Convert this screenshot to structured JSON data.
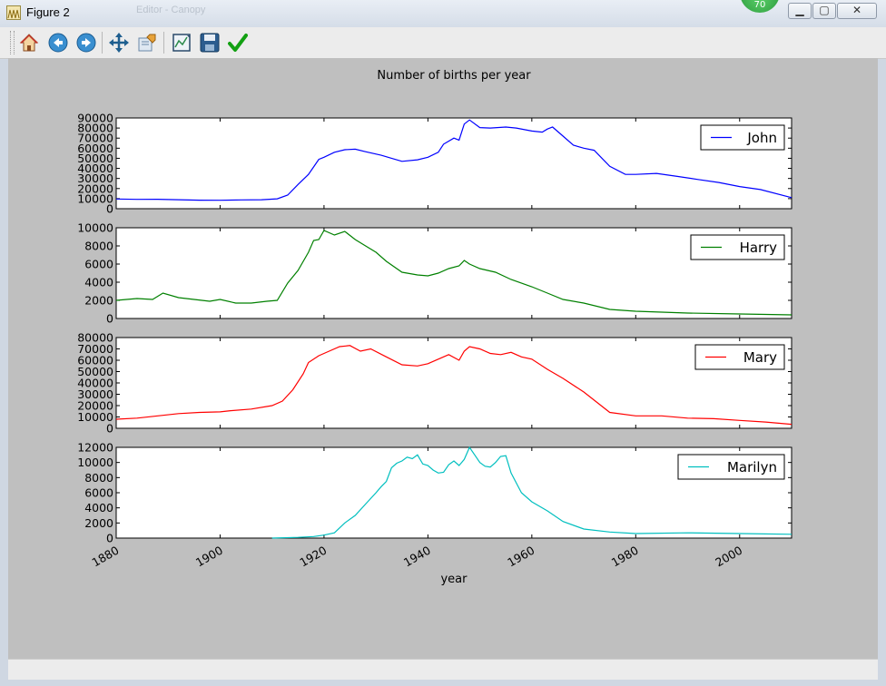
{
  "window": {
    "title": "Figure 2",
    "background_title": "Editor - Canopy",
    "badge": "70",
    "buttons": [
      {
        "name": "minimize-button",
        "glyph": "▁"
      },
      {
        "name": "maximize-button",
        "glyph": "▢"
      },
      {
        "name": "close-button",
        "glyph": "✕"
      }
    ]
  },
  "toolbar": {
    "items": [
      {
        "name": "home-icon"
      },
      {
        "name": "back-icon"
      },
      {
        "name": "forward-icon"
      },
      {
        "name": "pan-icon"
      },
      {
        "name": "zoom-icon"
      },
      {
        "name": "subplots-icon"
      },
      {
        "name": "save-icon"
      },
      {
        "name": "edit-axis-icon"
      }
    ]
  },
  "chart_data": {
    "type": "line",
    "title": "Number of births per year",
    "xlabel": "year",
    "xlim": [
      1880,
      2010
    ],
    "xticks": [
      "1880",
      "1900",
      "1920",
      "1940",
      "1960",
      "1980",
      "2000"
    ],
    "grid": false,
    "legend_placement": "right",
    "subplots": [
      {
        "name": "John",
        "color": "#0000ff",
        "ylim": [
          0,
          90000
        ],
        "yticks": [
          "0",
          "10000",
          "20000",
          "30000",
          "40000",
          "50000",
          "60000",
          "70000",
          "80000",
          "90000"
        ],
        "x": [
          1880,
          1884,
          1888,
          1892,
          1896,
          1900,
          1904,
          1908,
          1911,
          1913,
          1915,
          1917,
          1919,
          1920,
          1922,
          1924,
          1926,
          1928,
          1931,
          1933,
          1935,
          1938,
          1940,
          1942,
          1943,
          1945,
          1946,
          1947,
          1948,
          1950,
          1952,
          1955,
          1957,
          1960,
          1962,
          1963,
          1964,
          1966,
          1968,
          1970,
          1972,
          1975,
          1978,
          1980,
          1984,
          1988,
          1992,
          1996,
          2000,
          2004,
          2010
        ],
        "values": [
          9600,
          9300,
          9400,
          8900,
          8500,
          8400,
          8700,
          8900,
          9800,
          13500,
          24000,
          34000,
          49000,
          51000,
          56000,
          58500,
          59000,
          56500,
          53000,
          50000,
          47000,
          48500,
          51000,
          56000,
          64000,
          70000,
          68000,
          84000,
          88000,
          80500,
          80000,
          81000,
          80000,
          77000,
          76000,
          79000,
          81000,
          72000,
          63000,
          60000,
          58000,
          42000,
          34000,
          34000,
          35000,
          32000,
          29000,
          26000,
          22000,
          19000,
          11000
        ]
      },
      {
        "name": "Harry",
        "color": "#008000",
        "ylim": [
          0,
          10000
        ],
        "yticks": [
          "0",
          "2000",
          "4000",
          "6000",
          "8000",
          "10000"
        ],
        "x": [
          1880,
          1884,
          1887,
          1889,
          1892,
          1895,
          1898,
          1900,
          1903,
          1906,
          1909,
          1911,
          1913,
          1915,
          1917,
          1918,
          1919,
          1920,
          1922,
          1924,
          1926,
          1928,
          1930,
          1932,
          1935,
          1938,
          1940,
          1942,
          1944,
          1946,
          1947,
          1948,
          1950,
          1953,
          1956,
          1960,
          1963,
          1966,
          1970,
          1975,
          1980,
          1985,
          1990,
          2000,
          2010
        ],
        "values": [
          2000,
          2200,
          2100,
          2800,
          2300,
          2100,
          1900,
          2100,
          1700,
          1700,
          1900,
          2000,
          3900,
          5300,
          7300,
          8600,
          8700,
          9700,
          9200,
          9600,
          8700,
          8000,
          7300,
          6300,
          5100,
          4800,
          4700,
          5000,
          5500,
          5800,
          6400,
          6000,
          5500,
          5100,
          4300,
          3500,
          2800,
          2100,
          1700,
          1000,
          800,
          700,
          600,
          500,
          400
        ]
      },
      {
        "name": "Mary",
        "color": "#ff0000",
        "ylim": [
          0,
          80000
        ],
        "yticks": [
          "0",
          "10000",
          "20000",
          "30000",
          "40000",
          "50000",
          "60000",
          "70000",
          "80000"
        ],
        "x": [
          1880,
          1884,
          1888,
          1892,
          1896,
          1900,
          1902,
          1906,
          1910,
          1912,
          1914,
          1916,
          1917,
          1919,
          1921,
          1923,
          1925,
          1927,
          1929,
          1932,
          1935,
          1938,
          1940,
          1942,
          1944,
          1946,
          1947,
          1948,
          1950,
          1952,
          1954,
          1956,
          1958,
          1960,
          1963,
          1966,
          1970,
          1975,
          1980,
          1985,
          1990,
          1995,
          2000,
          2005,
          2010
        ],
        "values": [
          8000,
          9000,
          11000,
          13000,
          14000,
          14500,
          15500,
          17000,
          20000,
          24000,
          34000,
          48000,
          58000,
          64000,
          68000,
          72000,
          73000,
          68000,
          70000,
          63000,
          56000,
          55000,
          57000,
          61000,
          65000,
          60000,
          68000,
          72000,
          70000,
          66000,
          65000,
          67000,
          63000,
          61000,
          52000,
          44000,
          32000,
          14000,
          11000,
          11000,
          9000,
          8500,
          7000,
          5500,
          3500
        ]
      },
      {
        "name": "Marilyn",
        "color": "#00bfbf",
        "ylim": [
          0,
          12000
        ],
        "yticks": [
          "0",
          "2000",
          "4000",
          "6000",
          "8000",
          "10000",
          "12000"
        ],
        "x": [
          1910,
          1915,
          1918,
          1920,
          1922,
          1924,
          1926,
          1928,
          1930,
          1931,
          1932,
          1933,
          1934,
          1935,
          1936,
          1937,
          1938,
          1939,
          1940,
          1941,
          1942,
          1943,
          1944,
          1945,
          1946,
          1947,
          1948,
          1949,
          1950,
          1951,
          1952,
          1953,
          1954,
          1955,
          1956,
          1958,
          1960,
          1963,
          1966,
          1970,
          1975,
          1980,
          1990,
          2000,
          2010
        ],
        "values": [
          0,
          100,
          200,
          400,
          700,
          2000,
          3000,
          4500,
          6000,
          6800,
          7500,
          9300,
          9900,
          10200,
          10700,
          10500,
          11000,
          9800,
          9600,
          9000,
          8600,
          8700,
          9700,
          10200,
          9600,
          10400,
          12000,
          11000,
          10000,
          9500,
          9400,
          10000,
          10800,
          10900,
          8600,
          6000,
          4800,
          3600,
          2200,
          1200,
          800,
          600,
          700,
          600,
          500
        ]
      }
    ]
  }
}
